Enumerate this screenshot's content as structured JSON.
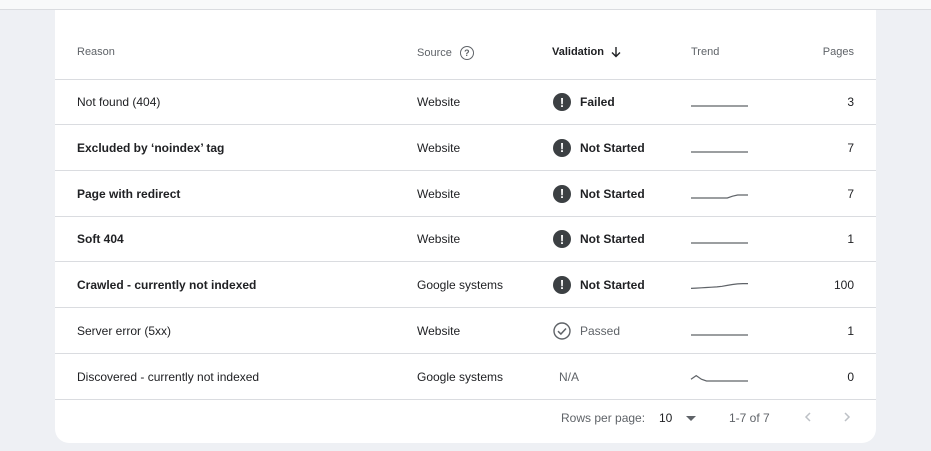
{
  "table": {
    "headers": {
      "reason": "Reason",
      "source": "Source",
      "validation": "Validation",
      "trend": "Trend",
      "pages": "Pages"
    },
    "rows": [
      {
        "reason": "Not found (404)",
        "bold": false,
        "source": "Website",
        "validation": "Failed",
        "status": "error",
        "pages": "3",
        "trend": [
          0,
          0,
          0,
          0,
          0,
          0,
          0,
          0,
          0,
          0,
          0,
          0
        ]
      },
      {
        "reason": "Excluded by ‘noindex’ tag",
        "bold": true,
        "source": "Website",
        "validation": "Not Started",
        "status": "error",
        "pages": "7",
        "trend": [
          0,
          0,
          0,
          0,
          0,
          0,
          0,
          0,
          0,
          0,
          0,
          0
        ]
      },
      {
        "reason": "Page with redirect",
        "bold": true,
        "source": "Website",
        "validation": "Not Started",
        "status": "error",
        "pages": "7",
        "trend": [
          0,
          0,
          0,
          0,
          0,
          0,
          0,
          0,
          0.3,
          0.5,
          0.5,
          0.5
        ]
      },
      {
        "reason": "Soft 404",
        "bold": true,
        "source": "Website",
        "validation": "Not Started",
        "status": "error",
        "pages": "1",
        "trend": [
          0,
          0,
          0,
          0,
          0,
          0,
          0,
          0,
          0,
          0,
          0,
          0
        ]
      },
      {
        "reason": "Crawled - currently not indexed",
        "bold": true,
        "source": "Google systems",
        "validation": "Not Started",
        "status": "error",
        "pages": "100",
        "trend": [
          0.1,
          0.15,
          0.2,
          0.25,
          0.3,
          0.35,
          0.45,
          0.6,
          0.75,
          0.85,
          0.9,
          0.9
        ]
      },
      {
        "reason": "Server error (5xx)",
        "bold": false,
        "source": "Website",
        "validation": "Passed",
        "status": "passed",
        "pages": "1",
        "trend": [
          0,
          0,
          0,
          0,
          0,
          0,
          0,
          0,
          0,
          0,
          0,
          0
        ]
      },
      {
        "reason": "Discovered - currently not indexed",
        "bold": false,
        "source": "Google systems",
        "validation": "N/A",
        "status": "na",
        "pages": "0",
        "trend": [
          0.3,
          0.9,
          0.3,
          0,
          0,
          0,
          0,
          0,
          0,
          0,
          0,
          0
        ]
      }
    ]
  },
  "pagination": {
    "rows_per_page_label": "Rows per page:",
    "rows_per_page_value": "10",
    "range": "1-7 of 7"
  },
  "icons": {
    "help": "help-circle-icon",
    "sort": "arrow-down-icon",
    "error": "exclamation-circle-icon",
    "passed": "check-circle-icon",
    "prev": "chevron-left-icon",
    "next": "chevron-right-icon"
  }
}
